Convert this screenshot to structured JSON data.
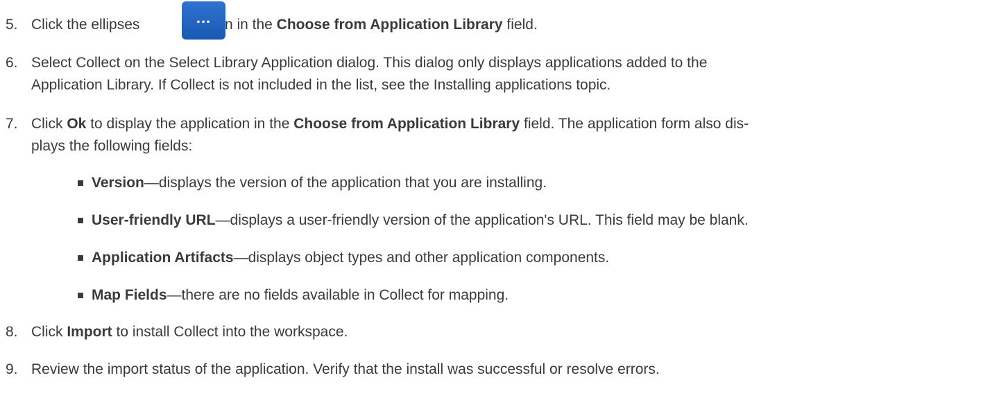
{
  "steps": [
    {
      "num": "5.",
      "pre": "Click the ellipses",
      "mid": " button in the ",
      "bold1": "Choose from Application Library",
      "post": " field."
    },
    {
      "num": "6.",
      "line1": "Select Collect on the Select Library Application dialog. This dialog only displays applications added to the",
      "line2": "Application Library. If Collect is not included in the list, see the Installing applications topic."
    },
    {
      "num": "7.",
      "pre": "Click ",
      "bold1": "Ok",
      "mid": " to display the application in the ",
      "bold2": "Choose from Application Library",
      "post": " field. The application form also dis-",
      "line2": "plays the following fields:"
    },
    {
      "num": "8.",
      "pre": "Click ",
      "bold1": "Import",
      "post": " to install Collect into the workspace."
    },
    {
      "num": "9.",
      "line1": "Review the import status of the application. Verify that the install was successful or resolve errors."
    }
  ],
  "ellipsis_button": {
    "label": "..."
  },
  "fields": [
    {
      "term": "Version",
      "desc": "—displays the version of the application that you are installing."
    },
    {
      "term": "User-friendly URL",
      "desc": "—displays a user-friendly version of the application's URL. This field may be blank."
    },
    {
      "term": "Application Artifacts",
      "desc": "—displays object types and other application components."
    },
    {
      "term": "Map Fields",
      "desc": "—there are no fields available in Collect for mapping."
    }
  ]
}
